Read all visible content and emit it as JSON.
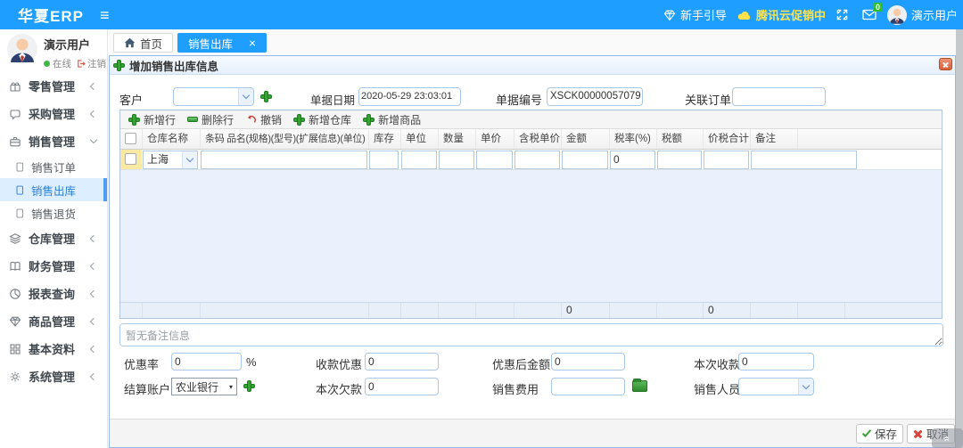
{
  "navbar": {
    "brand": "华夏ERP",
    "guide": "新手引导",
    "promo": "腾讯云促销中",
    "mail_badge": "0",
    "user": "演示用户"
  },
  "sidebar": {
    "user": {
      "name": "演示用户",
      "online": "在线",
      "logout": "注销"
    },
    "items": [
      {
        "label": "零售管理"
      },
      {
        "label": "采购管理"
      },
      {
        "label": "销售管理"
      },
      {
        "label": "仓库管理"
      },
      {
        "label": "财务管理"
      },
      {
        "label": "报表查询"
      },
      {
        "label": "商品管理"
      },
      {
        "label": "基本资料"
      },
      {
        "label": "系统管理"
      }
    ],
    "subitems": [
      {
        "label": "销售订单"
      },
      {
        "label": "销售出库"
      },
      {
        "label": "销售退货"
      }
    ]
  },
  "tabs": [
    {
      "label": "首页"
    },
    {
      "label": "销售出库"
    }
  ],
  "dialog": {
    "title": "增加销售出库信息",
    "fields": {
      "customer_label": "客户",
      "date_label": "单据日期",
      "date_value": "2020-05-29 23:03:01",
      "number_label": "单据编号",
      "number_value": "XSCK00000057079",
      "linked_label": "关联订单",
      "linked_value": ""
    },
    "toolbar": [
      {
        "label": "新增行"
      },
      {
        "label": "删除行"
      },
      {
        "label": "撤销"
      },
      {
        "label": "新增仓库"
      },
      {
        "label": "新增商品"
      }
    ],
    "table": {
      "columns": [
        "仓库名称",
        "条码 品名(规格)(型号)(扩展信息)(单位)",
        "库存",
        "单位",
        "数量",
        "单价",
        "含税单价",
        "金额",
        "税率(%)",
        "税额",
        "价税合计",
        "备注"
      ],
      "row": {
        "warehouse": "上海",
        "tax_rate": "0"
      },
      "footer": {
        "amount_total": "0",
        "total_with_tax": "0"
      }
    },
    "remark_placeholder": "暂无备注信息",
    "bottom": {
      "discount_rate_label": "优惠率",
      "discount_rate": "0",
      "percent": "%",
      "payment_discount_label": "收款优惠",
      "payment_discount": "0",
      "after_discount_label": "优惠后金额",
      "after_discount": "0",
      "receipt_label": "本次收款",
      "receipt": "0",
      "account_label": "结算账户",
      "account": "农业银行",
      "debt_label": "本次欠款",
      "debt": "0",
      "expense_label": "销售费用",
      "expense": "",
      "salesman_label": "销售人员",
      "salesman": ""
    },
    "buttons": {
      "save": "保存",
      "cancel": "取消"
    }
  }
}
